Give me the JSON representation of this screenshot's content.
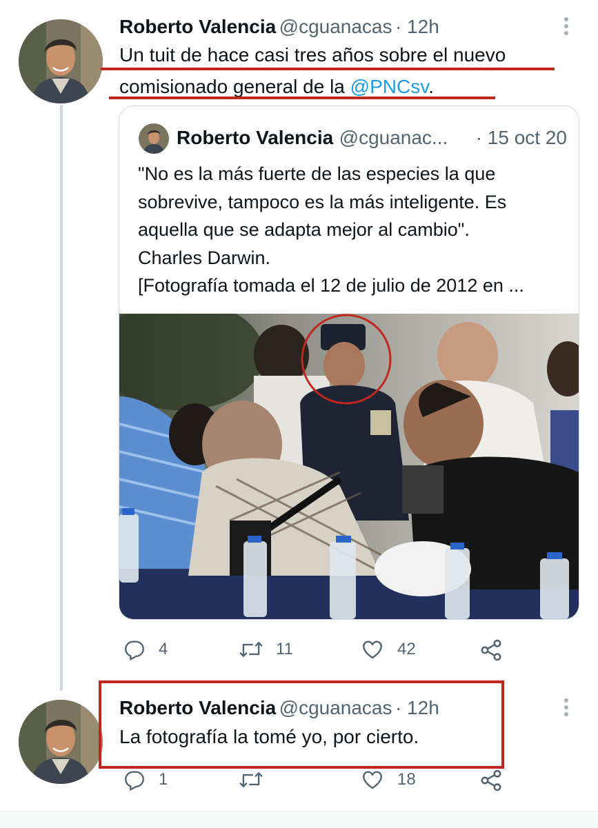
{
  "tweet1": {
    "author_name": "Roberto Valencia",
    "handle": "@cguanacas",
    "time": "· 12h",
    "text_line1": "Un tuit de hace casi tres años sobre el nuevo",
    "text_line2_prefix": "comisionado general de la ",
    "mention": "@PNCsv",
    "text_line2_suffix": ".",
    "more_icon": "more-vertical-icon"
  },
  "quoted": {
    "author_name": "Roberto Valencia",
    "handle": "@cguanac...",
    "time": "· 15 oct 20",
    "lines": [
      "\"No es la más fuerte de las especies la que",
      "sobrevive, tampoco es la más inteligente. Es",
      "aquella que se adapta mejor al cambio\".",
      "Charles Darwin.",
      "[Fotografía tomada el 12 de julio de 2012 en ..."
    ]
  },
  "tweet1_actions": {
    "replies": "4",
    "retweets": "11",
    "likes": "42"
  },
  "tweet2": {
    "author_name": "Roberto Valencia",
    "handle": "@cguanacas",
    "time": "· 12h",
    "text": "La fotografía la tomé yo, por cierto."
  },
  "tweet2_actions": {
    "replies": "1",
    "retweets": "",
    "likes": "18"
  },
  "colors": {
    "accent": "#1d9bf0",
    "annotation_red": "#c0281f",
    "secondary_text": "#536471",
    "border": "#cfd9de"
  },
  "icons": [
    "reply-icon",
    "retweet-icon",
    "like-icon",
    "share-icon",
    "more-vertical-icon"
  ]
}
